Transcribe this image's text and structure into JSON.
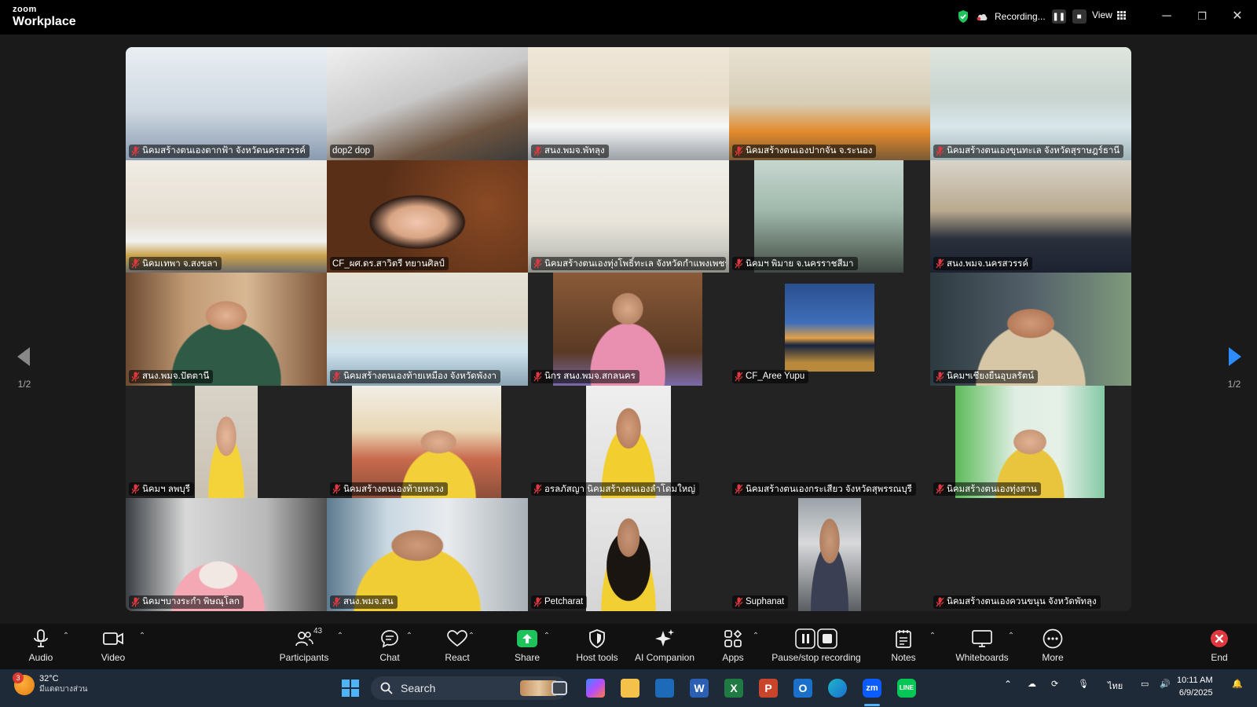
{
  "app": {
    "brand_top": "zoom",
    "brand_bottom": "Workplace"
  },
  "titlebar": {
    "recording_label": "Recording...",
    "view_label": "View"
  },
  "pager": {
    "left_indicator": "1/2",
    "right_indicator": "1/2"
  },
  "participants": [
    {
      "name": "นิคมสร้างตนเองตากฟ้า จังหวัดนครสวรรค์",
      "muted": true,
      "scene": "office-blue"
    },
    {
      "name": "dop2 dop",
      "muted": false,
      "scene": "meeting-gray"
    },
    {
      "name": "สนง.พมจ.พัทลุง",
      "muted": true,
      "scene": "conference-flags"
    },
    {
      "name": "นิคมสร้างตนเองปากจั่น จ.ระนอง",
      "muted": true,
      "scene": "hall-orange"
    },
    {
      "name": "นิคมสร้างตนเองขุนทะเล จังหวัดสุราษฎร์ธานี",
      "muted": true,
      "scene": "room-light"
    },
    {
      "name": "นิคมเทพา จ.สงขลา",
      "muted": true,
      "scene": "office-flags"
    },
    {
      "name": "CF_ผศ.ดร.สาวิตรี ทยานศิลป์",
      "muted": false,
      "scene": "speaker-bokeh",
      "active": true
    },
    {
      "name": "นิคมสร้างตนเองทุ่งโพธิ์ทะเล จังหวัดกำแพงเพชร",
      "muted": true,
      "scene": "office-white"
    },
    {
      "name": "นิคมฯ พิมาย จ.นครราชสีมา",
      "muted": true,
      "scene": "room-green"
    },
    {
      "name": "สนง.พมจ.นครสวรรค์",
      "muted": true,
      "scene": "office-boxes"
    },
    {
      "name": "สนง.พมจ.ปัตตานี",
      "muted": true,
      "scene": "person-curtain"
    },
    {
      "name": "นิคมสร้างตนเองท้ายเหมือง จังหวัดพังงา",
      "muted": true,
      "scene": "desk-mic"
    },
    {
      "name": "นิกร สนง.พมจ.สกลนคร",
      "muted": true,
      "scene": "person-pink"
    },
    {
      "name": "CF_Aree Yupu",
      "muted": true,
      "scene": "avatar-building"
    },
    {
      "name": "นิคมฯเชียงยืนอุบลรัตน์",
      "muted": true,
      "scene": "person-glasses"
    },
    {
      "name": "นิคมฯ ลพบุรี",
      "muted": true,
      "scene": "person-yellow-narrow"
    },
    {
      "name": "นิคมสร้างตนเองท้ายหลวง",
      "muted": true,
      "scene": "person-map"
    },
    {
      "name": "อรลภัสญา นิคมสร้างตนเองลำโดมใหญ่",
      "muted": true,
      "scene": "person-yellow-portrait"
    },
    {
      "name": "นิคมสร้างตนเองกระเสียว จังหวัดสุพรรณบุรี",
      "muted": true,
      "scene": "empty"
    },
    {
      "name": "นิคมสร้างตนเองทุ่งสาน",
      "muted": true,
      "scene": "person-green-room"
    },
    {
      "name": "นิคมฯบางระกำ พิษณุโลก",
      "muted": true,
      "scene": "person-mask"
    },
    {
      "name": "สนง.พมจ.สน",
      "muted": true,
      "scene": "person-window"
    },
    {
      "name": "Petcharat",
      "muted": true,
      "scene": "person-longhair"
    },
    {
      "name": "Suphanat",
      "muted": true,
      "scene": "person-car"
    },
    {
      "name": "นิคมสร้างตนเองควนขนุน จังหวัดพัทลุง",
      "muted": true,
      "scene": "empty"
    }
  ],
  "toolbar": {
    "audio": "Audio",
    "video": "Video",
    "participants": "Participants",
    "participants_count": "43",
    "chat": "Chat",
    "react": "React",
    "share": "Share",
    "host_tools": "Host tools",
    "ai_companion": "AI Companion",
    "apps": "Apps",
    "pause_stop_recording": "Pause/stop recording",
    "notes": "Notes",
    "whiteboards": "Whiteboards",
    "more": "More",
    "end": "End"
  },
  "taskbar": {
    "weather_temp": "32°C",
    "weather_desc": "มีแดดบางส่วน",
    "weather_badge": "3",
    "search_placeholder": "Search",
    "lang": "ไทย",
    "time": "10:11 AM",
    "date": "6/9/2025"
  },
  "colors": {
    "active_speaker": "#35c36a",
    "share_green": "#1ec35b",
    "end_red": "#e0383e"
  }
}
